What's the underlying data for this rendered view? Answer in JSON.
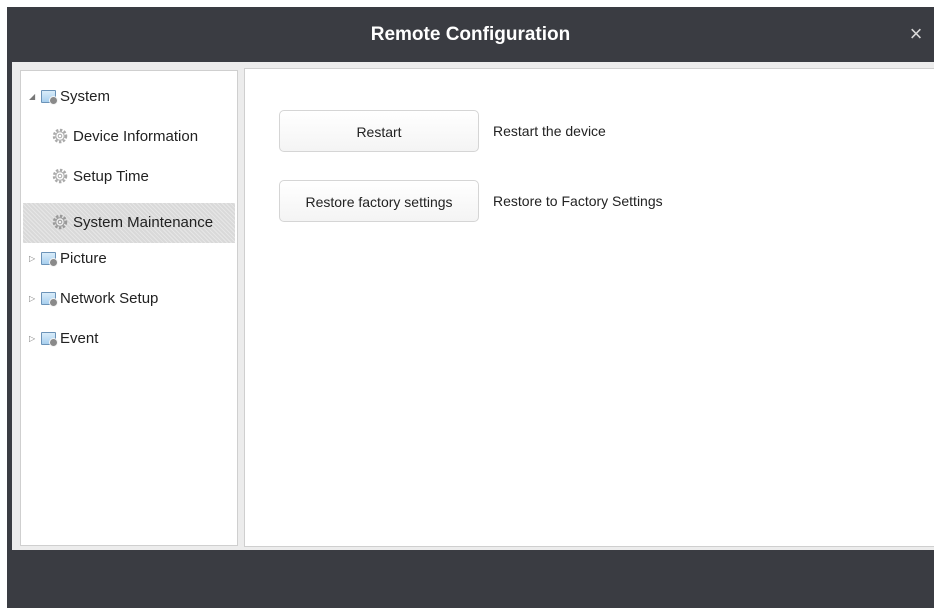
{
  "window": {
    "title": "Remote Configuration",
    "close_glyph": "×"
  },
  "sidebar": {
    "items": [
      {
        "label": "System",
        "icon": "folder-icon",
        "expanded": true
      },
      {
        "label": "Device Information",
        "icon": "gear-icon"
      },
      {
        "label": "Setup Time",
        "icon": "gear-icon"
      },
      {
        "label": "System Maintenance",
        "icon": "gear-icon",
        "selected": true
      },
      {
        "label": "Picture",
        "icon": "folder-icon",
        "expanded": false
      },
      {
        "label": "Network Setup",
        "icon": "folder-icon",
        "expanded": false
      },
      {
        "label": "Event",
        "icon": "folder-icon",
        "expanded": false
      }
    ],
    "arrow_expanded": "◢",
    "arrow_collapsed": "▷"
  },
  "main": {
    "actions": [
      {
        "button_label": "Restart",
        "description": "Restart the device"
      },
      {
        "button_label": "Restore factory settings",
        "description": "Restore to Factory Settings"
      }
    ]
  },
  "colors": {
    "titlebar": "#3a3c42",
    "selected_row": "#d9d9d9",
    "panel_background": "#ececec"
  }
}
